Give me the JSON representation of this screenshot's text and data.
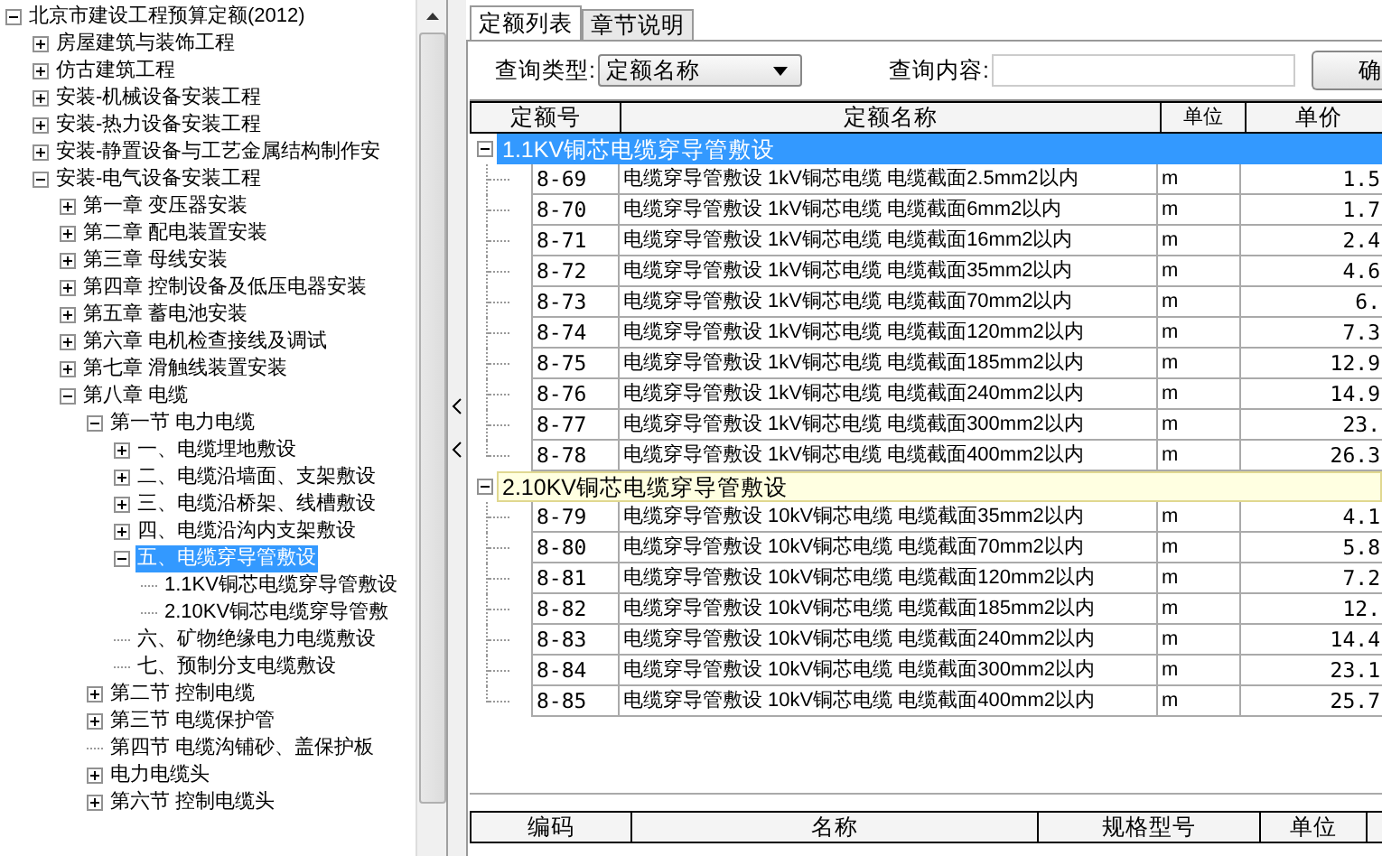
{
  "tree": [
    {
      "label": "北京市建设工程预算定额(2012)",
      "kind": "node",
      "expanded": true,
      "selected": false,
      "children": [
        {
          "label": "房屋建筑与装饰工程",
          "kind": "node",
          "expanded": false,
          "selected": false
        },
        {
          "label": "仿古建筑工程",
          "kind": "node",
          "expanded": false,
          "selected": false
        },
        {
          "label": "安装-机械设备安装工程",
          "kind": "node",
          "expanded": false,
          "selected": false
        },
        {
          "label": "安装-热力设备安装工程",
          "kind": "node",
          "expanded": false,
          "selected": false
        },
        {
          "label": "安装-静置设备与工艺金属结构制作安",
          "kind": "node",
          "expanded": false,
          "selected": false
        },
        {
          "label": "安装-电气设备安装工程",
          "kind": "node",
          "expanded": true,
          "selected": false,
          "children": [
            {
              "label": "第一章 变压器安装",
              "kind": "node",
              "expanded": false,
              "selected": false
            },
            {
              "label": "第二章 配电装置安装",
              "kind": "node",
              "expanded": false,
              "selected": false
            },
            {
              "label": "第三章 母线安装",
              "kind": "node",
              "expanded": false,
              "selected": false
            },
            {
              "label": "第四章 控制设备及低压电器安装",
              "kind": "node",
              "expanded": false,
              "selected": false
            },
            {
              "label": "第五章 蓄电池安装",
              "kind": "node",
              "expanded": false,
              "selected": false
            },
            {
              "label": "第六章 电机检查接线及调试",
              "kind": "node",
              "expanded": false,
              "selected": false
            },
            {
              "label": "第七章 滑触线装置安装",
              "kind": "node",
              "expanded": false,
              "selected": false
            },
            {
              "label": "第八章 电缆",
              "kind": "node",
              "expanded": true,
              "selected": false,
              "children": [
                {
                  "label": "第一节 电力电缆",
                  "kind": "node",
                  "expanded": true,
                  "selected": false,
                  "children": [
                    {
                      "label": "一、电缆埋地敷设",
                      "kind": "node",
                      "expanded": false,
                      "selected": false
                    },
                    {
                      "label": "二、电缆沿墙面、支架敷设",
                      "kind": "node",
                      "expanded": false,
                      "selected": false
                    },
                    {
                      "label": "三、电缆沿桥架、线槽敷设",
                      "kind": "node",
                      "expanded": false,
                      "selected": false
                    },
                    {
                      "label": "四、电缆沿沟内支架敷设",
                      "kind": "node",
                      "expanded": false,
                      "selected": false
                    },
                    {
                      "label": "五、电缆穿导管敷设",
                      "kind": "node",
                      "expanded": true,
                      "selected": true,
                      "children": [
                        {
                          "label": "1.1KV铜芯电缆穿导管敷设",
                          "kind": "leaf",
                          "selected": false
                        },
                        {
                          "label": "2.10KV铜芯电缆穿导管敷",
                          "kind": "leaf",
                          "selected": false
                        }
                      ]
                    },
                    {
                      "label": "六、矿物绝缘电力电缆敷设",
                      "kind": "leaf",
                      "selected": false
                    },
                    {
                      "label": "七、预制分支电缆敷设",
                      "kind": "leaf",
                      "selected": false
                    }
                  ]
                },
                {
                  "label": "第二节 控制电缆",
                  "kind": "node",
                  "expanded": false,
                  "selected": false
                },
                {
                  "label": "第三节 电缆保护管",
                  "kind": "node",
                  "expanded": false,
                  "selected": false
                },
                {
                  "label": "第四节 电缆沟铺砂、盖保护板",
                  "kind": "leaf",
                  "selected": false
                },
                {
                  "label": "电力电缆头",
                  "kind": "node",
                  "expanded": false,
                  "selected": false
                },
                {
                  "label": "第六节 控制电缆头",
                  "kind": "node",
                  "expanded": false,
                  "selected": false
                }
              ]
            }
          ]
        }
      ]
    }
  ],
  "tabs": [
    {
      "label": "定额列表",
      "selected": true
    },
    {
      "label": "章节说明",
      "selected": false
    }
  ],
  "query": {
    "type_label": "查询类型:",
    "type_value": "定额名称",
    "content_label": "查询内容:",
    "button": "确"
  },
  "table": {
    "columns": [
      "定额号",
      "定额名称",
      "单位",
      "单价"
    ],
    "groups": [
      {
        "title": "1.1KV铜芯电缆穿导管敷设",
        "selected": true,
        "focused": false,
        "rows": [
          {
            "code": "8-69",
            "name": "电缆穿导管敷设 1kV铜芯电缆 电缆截面2.5mm2以内",
            "unit": "m",
            "price": "1.5"
          },
          {
            "code": "8-70",
            "name": "电缆穿导管敷设 1kV铜芯电缆 电缆截面6mm2以内",
            "unit": "m",
            "price": "1.7"
          },
          {
            "code": "8-71",
            "name": "电缆穿导管敷设 1kV铜芯电缆 电缆截面16mm2以内",
            "unit": "m",
            "price": "2.4"
          },
          {
            "code": "8-72",
            "name": "电缆穿导管敷设 1kV铜芯电缆 电缆截面35mm2以内",
            "unit": "m",
            "price": "4.6"
          },
          {
            "code": "8-73",
            "name": "电缆穿导管敷设 1kV铜芯电缆 电缆截面70mm2以内",
            "unit": "m",
            "price": "6."
          },
          {
            "code": "8-74",
            "name": "电缆穿导管敷设 1kV铜芯电缆 电缆截面120mm2以内",
            "unit": "m",
            "price": "7.3"
          },
          {
            "code": "8-75",
            "name": "电缆穿导管敷设 1kV铜芯电缆 电缆截面185mm2以内",
            "unit": "m",
            "price": "12.9"
          },
          {
            "code": "8-76",
            "name": "电缆穿导管敷设 1kV铜芯电缆 电缆截面240mm2以内",
            "unit": "m",
            "price": "14.9"
          },
          {
            "code": "8-77",
            "name": "电缆穿导管敷设 1kV铜芯电缆 电缆截面300mm2以内",
            "unit": "m",
            "price": "23."
          },
          {
            "code": "8-78",
            "name": "电缆穿导管敷设 1kV铜芯电缆 电缆截面400mm2以内",
            "unit": "m",
            "price": "26.3"
          }
        ]
      },
      {
        "title": "2.10KV铜芯电缆穿导管敷设",
        "selected": false,
        "focused": true,
        "rows": [
          {
            "code": "8-79",
            "name": "电缆穿导管敷设 10kV铜芯电缆 电缆截面35mm2以内",
            "unit": "m",
            "price": "4.1"
          },
          {
            "code": "8-80",
            "name": "电缆穿导管敷设 10kV铜芯电缆 电缆截面70mm2以内",
            "unit": "m",
            "price": "5.8"
          },
          {
            "code": "8-81",
            "name": "电缆穿导管敷设 10kV铜芯电缆 电缆截面120mm2以内",
            "unit": "m",
            "price": "7.2"
          },
          {
            "code": "8-82",
            "name": "电缆穿导管敷设 10kV铜芯电缆 电缆截面185mm2以内",
            "unit": "m",
            "price": "12."
          },
          {
            "code": "8-83",
            "name": "电缆穿导管敷设 10kV铜芯电缆 电缆截面240mm2以内",
            "unit": "m",
            "price": "14.4"
          },
          {
            "code": "8-84",
            "name": "电缆穿导管敷设 10kV铜芯电缆 电缆截面300mm2以内",
            "unit": "m",
            "price": "23.1"
          },
          {
            "code": "8-85",
            "name": "电缆穿导管敷设 10kV铜芯电缆 电缆截面400mm2以内",
            "unit": "m",
            "price": "25.7"
          }
        ]
      }
    ]
  },
  "detail_table": {
    "columns": [
      "编码",
      "名称",
      "规格型号",
      "单位"
    ]
  }
}
